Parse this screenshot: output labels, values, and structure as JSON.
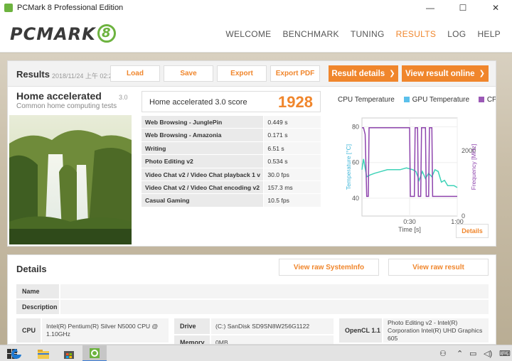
{
  "window": {
    "title": "PCMark 8 Professional Edition",
    "minimize": "—",
    "maximize": "☐",
    "close": "✕"
  },
  "logo": {
    "text": "PCMARK",
    "badge": "8"
  },
  "nav": {
    "items": [
      "WELCOME",
      "BENCHMARK",
      "TUNING",
      "RESULTS",
      "LOG",
      "HELP"
    ],
    "active": "RESULTS"
  },
  "results": {
    "title": "Results",
    "date": "2018/11/24 上午 02:2",
    "buttons": {
      "load": "Load",
      "save": "Save",
      "export": "Export",
      "export_pdf": "Export PDF",
      "result_details": "Result details",
      "view_online": "View result online"
    },
    "test": {
      "name": "Home accelerated",
      "description": "Common home computing tests",
      "version": "3.0"
    },
    "score": {
      "label": "Home accelerated 3.0 score",
      "value": "1928"
    },
    "rows": [
      {
        "name": "Web Browsing - JunglePin",
        "value": "0.449 s"
      },
      {
        "name": "Web Browsing - Amazonia",
        "value": "0.171 s"
      },
      {
        "name": "Writing",
        "value": "6.51 s"
      },
      {
        "name": "Photo Editing v2",
        "value": "0.534 s"
      },
      {
        "name": "Video Chat v2 / Video Chat playback 1 v",
        "value": "30.0 fps"
      },
      {
        "name": "Video Chat v2 / Video Chat encoding v2",
        "value": "157.3 ms"
      },
      {
        "name": "Casual Gaming",
        "value": "10.5 fps"
      }
    ],
    "details_button": "Details"
  },
  "chart_data": {
    "type": "line",
    "legend": [
      {
        "name": "CPU Temperature",
        "color": "#ffffff"
      },
      {
        "name": "GPU Temperature",
        "color": "#5bc0eb"
      },
      {
        "name": "CPU Cl",
        "color": "#9b59b6"
      }
    ],
    "ylabel_left": "Temperature [°C]",
    "ylabel_right": "Frequency [MHz]",
    "xlabel": "Time [s]",
    "x_ticks": [
      "0:30",
      "1:00"
    ],
    "yleft_ticks": [
      "80",
      "60",
      "40"
    ],
    "yleft_range": [
      30,
      85
    ],
    "yright_ticks": [
      "2000",
      "0"
    ],
    "yright_range": [
      0,
      3000
    ],
    "x_range_s": [
      0,
      60
    ],
    "series": [
      {
        "name": "GPU Temperature",
        "axis": "left",
        "color": "#3fd3b8",
        "x": [
          0,
          1,
          3,
          5,
          8,
          12,
          16,
          20,
          24,
          28,
          32,
          34,
          36,
          38,
          40,
          42,
          44,
          46,
          48,
          50,
          52,
          54,
          56,
          58,
          60
        ],
        "y": [
          56,
          62,
          52,
          53,
          54,
          55,
          56,
          56,
          56,
          57,
          56,
          55,
          50,
          55,
          51,
          54,
          52,
          56,
          55,
          49,
          50,
          47,
          47,
          47,
          46
        ]
      },
      {
        "name": "CPU Clock",
        "axis": "right",
        "color": "#8e44ad",
        "x": [
          0,
          1,
          2,
          3,
          4,
          4.5,
          8,
          12,
          16,
          20,
          24,
          30,
          30.5,
          33,
          33.5,
          35,
          35.5,
          37,
          37.5,
          40,
          40.5,
          42,
          42.5,
          44,
          44.5,
          50,
          50.5,
          56,
          60
        ],
        "y": [
          2700,
          2700,
          2500,
          600,
          600,
          2700,
          2700,
          2700,
          2700,
          2700,
          2700,
          2700,
          600,
          600,
          2700,
          2700,
          600,
          600,
          2700,
          2700,
          600,
          600,
          2700,
          2700,
          600,
          600,
          600,
          600,
          600
        ]
      }
    ]
  },
  "details": {
    "title": "Details",
    "buttons": {
      "raw_systeminfo": "View raw SystemInfo",
      "raw_result": "View raw result"
    },
    "name_label": "Name",
    "name_value": "",
    "description_label": "Description",
    "description_value": "",
    "cpu_label": "CPU",
    "cpu_value": "Intel(R) Pentium(R) Silver N5000 CPU @ 1.10GHz",
    "drive_label": "Drive",
    "drive_value": "(C:) SanDisk SD9SN8W256G1122",
    "memory_label": "Memory",
    "memory_value": "0MB",
    "opencl_label": "OpenCL 1.1",
    "opencl_value": "Photo Editing v2 - Intel(R) Corporation Intel(R) UHD Graphics 605"
  },
  "taskbar": {
    "items": [
      "start-button",
      "edge-icon",
      "file-explorer-icon",
      "store-icon",
      "pcmark-icon"
    ],
    "tray": {
      "people": "people-icon",
      "network": "network-icon",
      "volume": "volume-icon",
      "keyboard": "keyboard-icon"
    }
  }
}
